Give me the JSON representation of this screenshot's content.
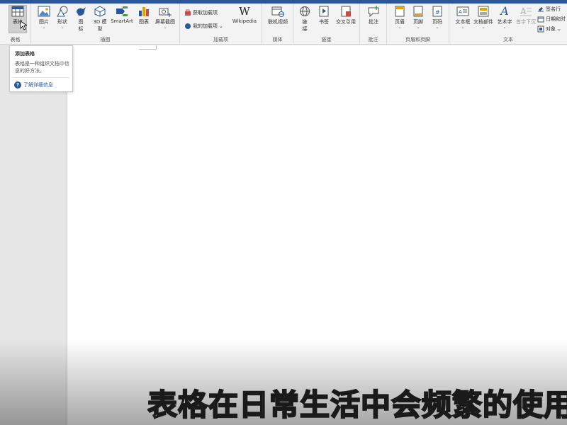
{
  "ribbon": {
    "groups": {
      "tables": {
        "label": "表格",
        "table_btn": "表格"
      },
      "illustrations": {
        "label": "插图",
        "picture": "图片",
        "shapes": "形状",
        "icons_a": "图",
        "icons_b": "标",
        "model3d_a": "3D 模",
        "model3d_b": "型",
        "smartart": "SmartArt",
        "chart": "图表",
        "screenshot": "屏幕截图"
      },
      "addins": {
        "label": "加载项",
        "get_addins": "获取加载项",
        "my_addins": "我的加载项",
        "wikipedia": "Wikipedia"
      },
      "media": {
        "label": "媒体",
        "online_video": "联机视频"
      },
      "links": {
        "label": "链接",
        "link_a": "链",
        "link_b": "接",
        "bookmark": "书签",
        "cross_ref": "交叉引用"
      },
      "comments": {
        "label": "批注",
        "comment": "批注"
      },
      "header_footer": {
        "label": "页眉和页脚",
        "header": "页眉",
        "footer": "页脚",
        "page_number": "页码"
      },
      "text": {
        "label": "文本",
        "textbox": "文本框",
        "quick_parts": "文档部件",
        "wordart": "艺术字",
        "dropcap": "首字下沉",
        "signature": "签名行",
        "datetime": "日期和时",
        "object": "对象"
      }
    }
  },
  "tooltip": {
    "title": "添加表格",
    "description": "表格是一种组织文档中信息的好方法。",
    "help_link": "了解详细信息"
  },
  "subtitle": "表格在日常生活中会频繁的使用",
  "colors": {
    "accent": "#2b579a",
    "ribbon_bg": "#f3f3f3",
    "doc_bg": "#ffffff"
  }
}
